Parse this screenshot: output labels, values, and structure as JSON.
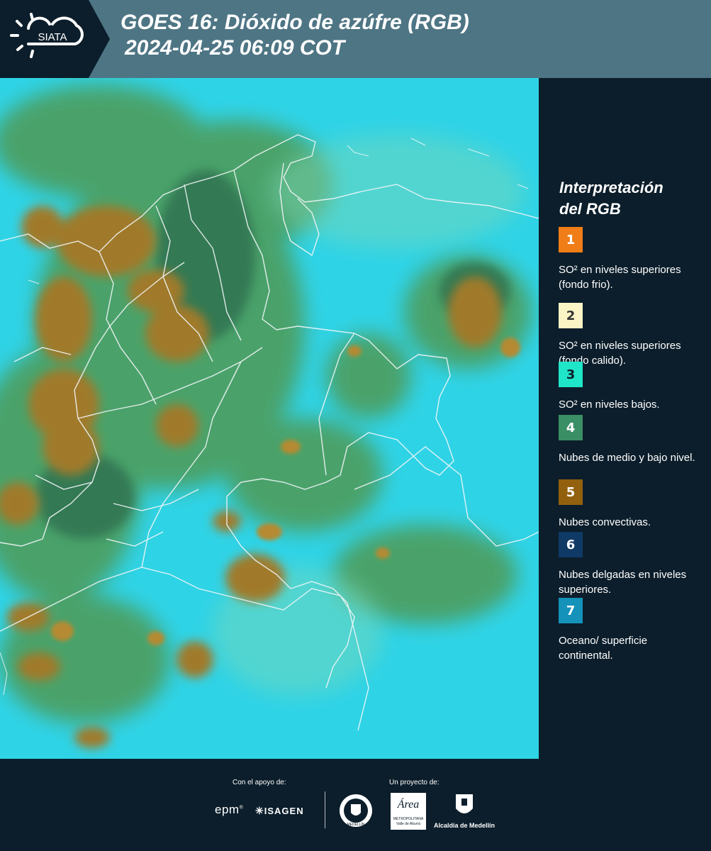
{
  "header": {
    "logo_text": "SIATA",
    "title_line1": "GOES 16: Dióxido de azúfre (RGB)",
    "title_line2": "2024-04-25 06:09 COT"
  },
  "legend": {
    "title_line1": "Interpretación",
    "title_line2": "del RGB",
    "items": [
      {
        "number": "1",
        "color": "#f07d17",
        "number_color": "#ffffff",
        "text": "SO² en niveles superiores (fondo frio)."
      },
      {
        "number": "2",
        "color": "#fbf4c4",
        "number_color": "#333333",
        "text": "SO² en niveles superiores (fondo calido)."
      },
      {
        "number": "3",
        "color": "#1fe6c8",
        "number_color": "#0c1e2b",
        "text": "SO² en niveles bajos."
      },
      {
        "number": "4",
        "color": "#3a8f65",
        "number_color": "#ffffff",
        "text": "Nubes de medio y bajo nivel."
      },
      {
        "number": "5",
        "color": "#93600e",
        "number_color": "#ffffff",
        "text": "Nubes convectivas."
      },
      {
        "number": "6",
        "color": "#0f3a66",
        "number_color": "#ffffff",
        "text": "Nubes delgadas en niveles superiores."
      },
      {
        "number": "7",
        "color": "#1592ba",
        "number_color": "#ffffff",
        "text": "Oceano/ superficie continental."
      }
    ]
  },
  "footer": {
    "support_label": "Con el apoyo de:",
    "project_label": "Un proyecto de:",
    "sponsor_epm": "epm",
    "sponsor_isagen": "ISAGEN",
    "seal_text": "MEDELLÍN",
    "area_title": "Área",
    "area_line1": "METROPOLITANA",
    "area_line2": "Valle de Aburrá",
    "alcaldia": "Alcaldía de Medellín"
  },
  "colors": {
    "header_bg": "#4e7584",
    "panel_bg": "#0c1e2b",
    "map_cyan": "#2fd3e6",
    "map_green": "#4f9a55",
    "map_brown": "#a07a2a"
  }
}
